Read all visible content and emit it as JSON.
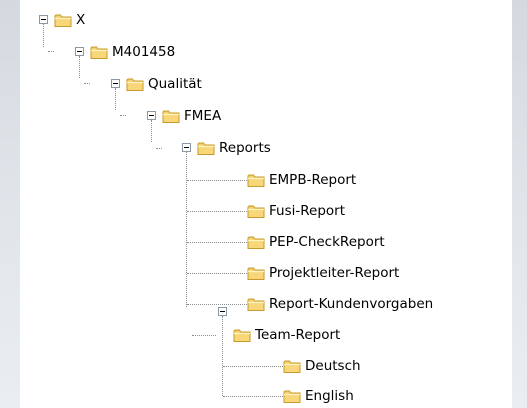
{
  "tree": {
    "root": {
      "label": "X",
      "expanded": true,
      "icon": "folder-icon"
    },
    "level1": {
      "label": "M401458",
      "expanded": true,
      "icon": "folder-icon"
    },
    "level2": {
      "label": "Qualität",
      "expanded": true,
      "icon": "folder-icon"
    },
    "level3": {
      "label": "FMEA",
      "expanded": true,
      "icon": "folder-icon"
    },
    "level4": {
      "label": "Reports",
      "expanded": true,
      "icon": "folder-icon"
    },
    "reports_children": [
      {
        "label": "EMPB-Report",
        "icon": "folder-icon"
      },
      {
        "label": "Fusi-Report",
        "icon": "folder-icon"
      },
      {
        "label": "PEP-CheckReport",
        "icon": "folder-icon"
      },
      {
        "label": "Projektleiter-Report",
        "icon": "folder-icon"
      },
      {
        "label": "Report-Kundenvorgaben",
        "icon": "folder-icon"
      },
      {
        "label": "Team-Report",
        "expanded": true,
        "icon": "folder-icon"
      }
    ],
    "team_report_children": [
      {
        "label": "Deutsch",
        "icon": "folder-icon"
      },
      {
        "label": "English",
        "icon": "folder-icon"
      }
    ]
  },
  "colors": {
    "folder_fill": "#f7d779",
    "folder_edge": "#c89a2c",
    "folder_tab": "#eec55a",
    "guide_line": "#8c8c8c",
    "toggle_border": "#8b98a5"
  }
}
